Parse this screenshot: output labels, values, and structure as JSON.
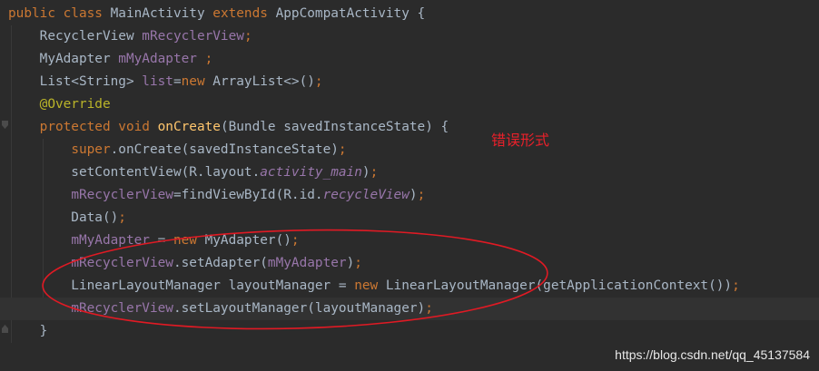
{
  "code": {
    "lines": [
      [
        {
          "t": "public class ",
          "c": "kw"
        },
        {
          "t": "MainActivity ",
          "c": "plain"
        },
        {
          "t": "extends ",
          "c": "kw"
        },
        {
          "t": "AppCompatActivity {",
          "c": "plain"
        }
      ],
      [
        {
          "t": "    RecyclerView ",
          "c": "plain"
        },
        {
          "t": "mRecyclerView",
          "c": "field"
        },
        {
          "t": ";",
          "c": "kw"
        }
      ],
      [
        {
          "t": "    MyAdapter ",
          "c": "plain"
        },
        {
          "t": "mMyAdapter ",
          "c": "field"
        },
        {
          "t": ";",
          "c": "kw"
        }
      ],
      [
        {
          "t": "    List<String> ",
          "c": "plain"
        },
        {
          "t": "list",
          "c": "field"
        },
        {
          "t": "=",
          "c": "plain"
        },
        {
          "t": "new ",
          "c": "kw"
        },
        {
          "t": "ArrayList<>()",
          "c": "plain"
        },
        {
          "t": ";",
          "c": "kw"
        }
      ],
      [
        {
          "t": "    ",
          "c": "plain"
        },
        {
          "t": "@Override",
          "c": "anno"
        }
      ],
      [
        {
          "t": "    ",
          "c": "plain"
        },
        {
          "t": "protected void ",
          "c": "kw"
        },
        {
          "t": "onCreate",
          "c": "method"
        },
        {
          "t": "(Bundle savedInstanceState) {",
          "c": "plain"
        }
      ],
      [
        {
          "t": "        ",
          "c": "plain"
        },
        {
          "t": "super",
          "c": "kw"
        },
        {
          "t": ".onCreate(savedInstanceState)",
          "c": "plain"
        },
        {
          "t": ";",
          "c": "kw"
        }
      ],
      [
        {
          "t": "        setContentView(R.layout.",
          "c": "plain"
        },
        {
          "t": "activity_main",
          "c": "static"
        },
        {
          "t": ")",
          "c": "plain"
        },
        {
          "t": ";",
          "c": "kw"
        }
      ],
      [
        {
          "t": "        ",
          "c": "plain"
        },
        {
          "t": "mRecyclerView",
          "c": "field"
        },
        {
          "t": "=findViewById(R.id.",
          "c": "plain"
        },
        {
          "t": "recycleView",
          "c": "static"
        },
        {
          "t": ")",
          "c": "plain"
        },
        {
          "t": ";",
          "c": "kw"
        }
      ],
      [
        {
          "t": "        Data()",
          "c": "plain"
        },
        {
          "t": ";",
          "c": "kw"
        }
      ],
      [
        {
          "t": "        ",
          "c": "plain"
        },
        {
          "t": "mMyAdapter ",
          "c": "field"
        },
        {
          "t": "= ",
          "c": "plain"
        },
        {
          "t": "new ",
          "c": "kw"
        },
        {
          "t": "MyAdapter()",
          "c": "plain"
        },
        {
          "t": ";",
          "c": "kw"
        }
      ],
      [
        {
          "t": "        ",
          "c": "plain"
        },
        {
          "t": "mRecyclerView",
          "c": "field"
        },
        {
          "t": ".setAdapter(",
          "c": "plain"
        },
        {
          "t": "mMyAdapter",
          "c": "field"
        },
        {
          "t": ")",
          "c": "plain"
        },
        {
          "t": ";",
          "c": "kw"
        }
      ],
      [
        {
          "t": "        LinearLayoutManager layoutManager = ",
          "c": "plain"
        },
        {
          "t": "new ",
          "c": "kw"
        },
        {
          "t": "LinearLayoutManager(getApplicationContext())",
          "c": "plain"
        },
        {
          "t": ";",
          "c": "kw"
        }
      ],
      [
        {
          "t": "        ",
          "c": "plain"
        },
        {
          "t": "mRecyclerView",
          "c": "field"
        },
        {
          "t": ".setLayoutManager(layoutManager)",
          "c": "plain"
        },
        {
          "t": ";",
          "c": "kw"
        }
      ],
      [
        {
          "t": "    }",
          "c": "plain"
        }
      ]
    ],
    "current_line": 13
  },
  "annotation": {
    "text": "错误形式",
    "color": "#e8202a"
  },
  "watermark": "https://blog.csdn.net/qq_45137584",
  "colors": {
    "background": "#2b2b2b",
    "current_line": "#323232",
    "keyword": "#cc7832",
    "field": "#9876aa",
    "method": "#ffc66d",
    "annotation": "#bbb529",
    "text": "#a9b7c6"
  }
}
